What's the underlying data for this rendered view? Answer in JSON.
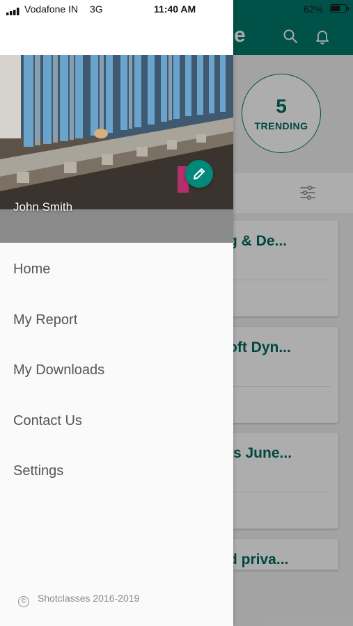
{
  "status_bar": {
    "carrier": "Vodafone IN",
    "network": "3G",
    "time": "11:40 AM",
    "battery_percent": "62%",
    "battery_level": 0.62
  },
  "background_app": {
    "title_fragment": "e",
    "trending": {
      "count": "5",
      "label": "TRENDING"
    },
    "cards": [
      {
        "title": "g & De..."
      },
      {
        "title": "oft Dyn..."
      },
      {
        "title": "ts June..."
      },
      {
        "title": "d priva..."
      }
    ]
  },
  "drawer": {
    "profile_name": "John Smith",
    "menu": [
      {
        "label": "Home"
      },
      {
        "label": "My Report"
      },
      {
        "label": "My Downloads"
      },
      {
        "label": "Contact Us"
      },
      {
        "label": "Settings"
      }
    ],
    "footer_symbol": "©",
    "footer": "Shotclasses 2016-2019"
  },
  "colors": {
    "primary": "#00796b",
    "accent": "#00897b",
    "menu_text": "#555555"
  },
  "icons": [
    "signal-icon",
    "search-icon",
    "bell-icon",
    "filter-icon",
    "edit-icon",
    "copyright-icon"
  ]
}
